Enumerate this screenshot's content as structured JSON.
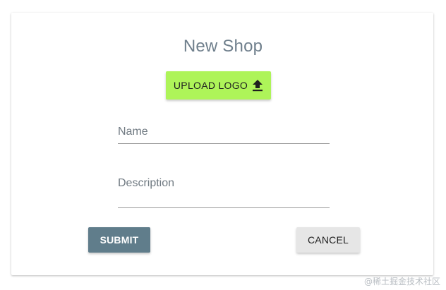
{
  "form": {
    "title": "New Shop",
    "upload_label": "UPLOAD LOGO",
    "upload_icon": "upload-arrow",
    "fields": {
      "name": {
        "label": "Name",
        "value": ""
      },
      "description": {
        "label": "Description",
        "value": ""
      }
    },
    "submit_label": "SUBMIT",
    "cancel_label": "CANCEL"
  },
  "colors": {
    "upload_button": "#aef459",
    "submit_button": "#607d8b",
    "cancel_button": "#e6e6e6",
    "title_text": "#6f7f8c"
  },
  "watermark": "@稀土掘金技术社区"
}
